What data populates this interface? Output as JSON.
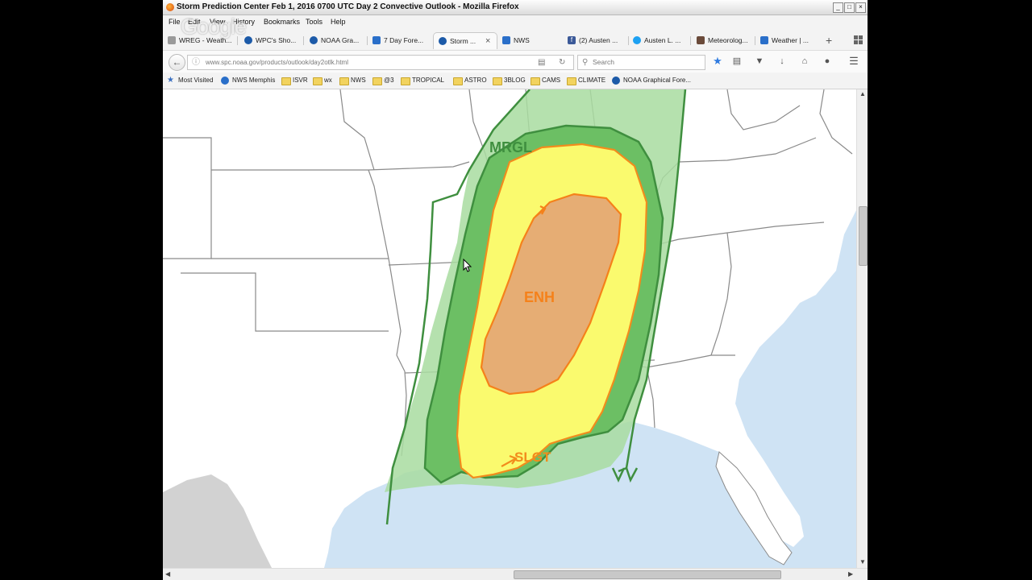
{
  "window": {
    "title": "Storm Prediction Center Feb 1, 2016 0700 UTC Day 2 Convective Outlook - Mozilla Firefox",
    "controls": [
      "_",
      "□",
      "×"
    ]
  },
  "watermark": "Google",
  "menu": [
    "File",
    "Edit",
    "View",
    "History",
    "Bookmarks",
    "Tools",
    "Help"
  ],
  "tabs": [
    {
      "label": "WREG - Weath...",
      "icon": "page-icon",
      "color": "#999999"
    },
    {
      "label": "WPC's Sho...",
      "icon": "noaa-icon",
      "color": "#1c5aa8"
    },
    {
      "label": "NOAA Gra...",
      "icon": "noaa-icon",
      "color": "#1c5aa8"
    },
    {
      "label": "7 Day Fore...",
      "icon": "nws-icon",
      "color": "#2a6fc9"
    },
    {
      "label": "Storm ...",
      "icon": "noaa-icon",
      "color": "#1c5aa8",
      "active": true
    },
    {
      "label": "NWS",
      "icon": "nws-icon",
      "color": "#2a6fc9"
    },
    {
      "label": "(2) Austen ...",
      "icon": "facebook-icon",
      "color": "#3b5998"
    },
    {
      "label": "Austen L. ...",
      "icon": "twitter-icon",
      "color": "#1da1f2"
    },
    {
      "label": "Meteorolog...",
      "icon": "instagram-icon",
      "color": "#6a4a3a"
    },
    {
      "label": "Weather | ...",
      "icon": "nws-icon",
      "color": "#2a6fc9"
    }
  ],
  "tab_close": "×",
  "new_tab": "+",
  "url": "www.spc.noaa.gov/products/outlook/day2otlk.html",
  "search_placeholder": "Search",
  "bookmarks": [
    {
      "label": "Most Visited",
      "icon": "star-icon"
    },
    {
      "label": "NWS Memphis",
      "icon": "nws-icon"
    },
    {
      "label": "ISVR",
      "icon": "folder-icon"
    },
    {
      "label": "wx",
      "icon": "folder-icon"
    },
    {
      "label": "NWS",
      "icon": "folder-icon"
    },
    {
      "label": "@3",
      "icon": "folder-icon"
    },
    {
      "label": "TROPICAL",
      "icon": "folder-icon"
    },
    {
      "label": "ASTRO",
      "icon": "folder-icon"
    },
    {
      "label": "3BLOG",
      "icon": "folder-icon"
    },
    {
      "label": "CAMS",
      "icon": "folder-icon"
    },
    {
      "label": "CLIMATE",
      "icon": "folder-icon"
    },
    {
      "label": "NOAA Graphical Fore...",
      "icon": "noaa-icon"
    }
  ],
  "map": {
    "labels": {
      "mrgl": "MRGL",
      "enh": "ENH",
      "slgt": "SLGT"
    },
    "colors": {
      "mrgl_fill": "#a8dca0",
      "mrgl_line": "#3f8f3f",
      "slgt_fill": "#fafa6e",
      "slgt_line": "#f28c1c",
      "enh_fill": "#e6ad74",
      "enh_line": "#f5811a",
      "water": "#cfe3f4",
      "land": "#ffffff",
      "mexico": "#d2d2d2"
    }
  }
}
